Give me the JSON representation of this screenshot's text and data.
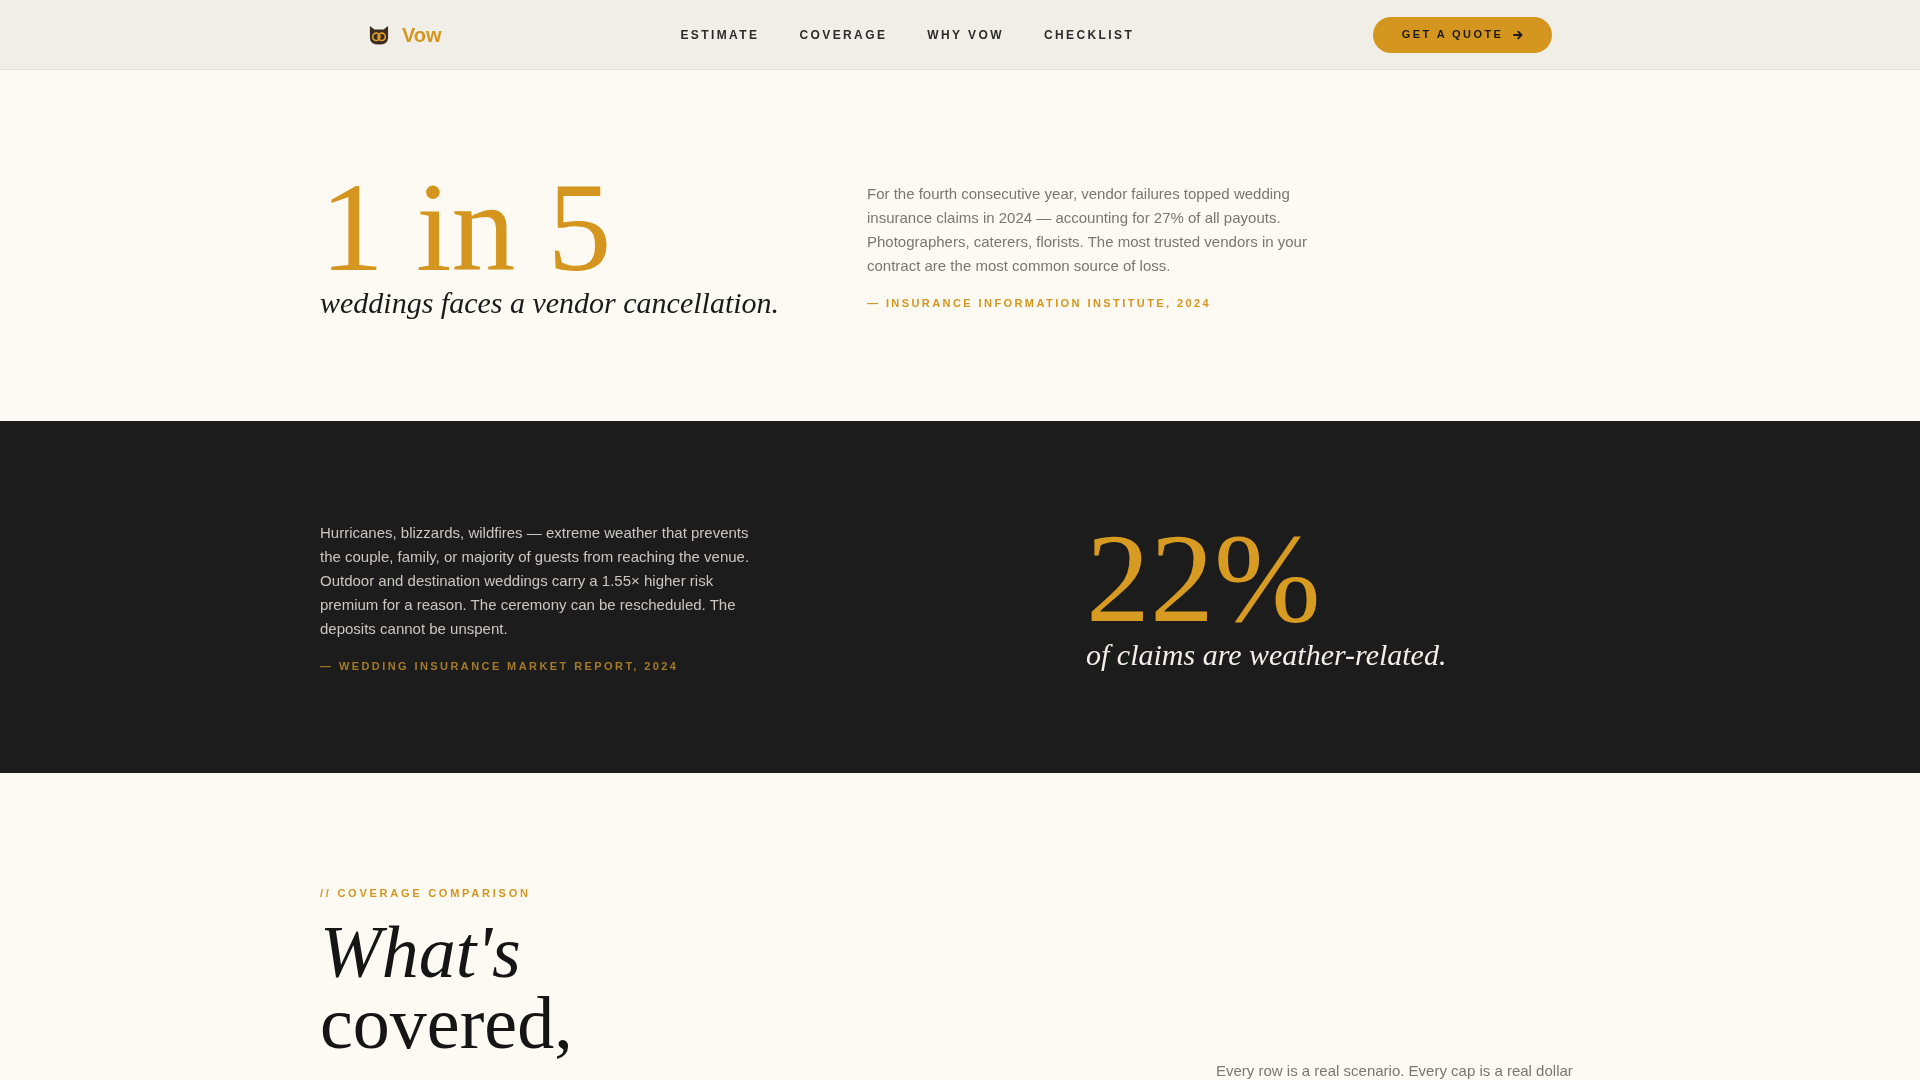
{
  "nav": {
    "brand": "Vow",
    "links": [
      "ESTIMATE",
      "COVERAGE",
      "WHY VOW",
      "CHECKLIST"
    ],
    "cta": "GET A QUOTE"
  },
  "stats": [
    {
      "kind": "light",
      "figure": "1 in 5",
      "caption": "weddings faces a vendor cancellation.",
      "body": "For the fourth consecutive year, vendor failures topped wedding insurance claims in 2024 — accounting for 27% of all payouts. Photographers, caterers, florists. The most trusted vendors in your contract are the most common source of loss.",
      "source": "— INSURANCE INFORMATION INSTITUTE, 2024"
    },
    {
      "kind": "dark",
      "figure": "22%",
      "caption": "of claims are weather-related.",
      "body": "Hurricanes, blizzards, wildfires — extreme weather that prevents the couple, family, or majority of guests from reaching the venue. Outdoor and destination weddings carry a 1.55× higher risk premium for a reason. The ceremony can be rescheduled. The deposits cannot be unspent.",
      "source": "— WEDDING INSURANCE MARKET REPORT, 2024"
    }
  ],
  "comparison": {
    "eyebrow": "// COVERAGE COMPARISON",
    "heading": "*What's* covered,",
    "intro": "Every row is a real scenario. Every cap is a real dollar"
  }
}
